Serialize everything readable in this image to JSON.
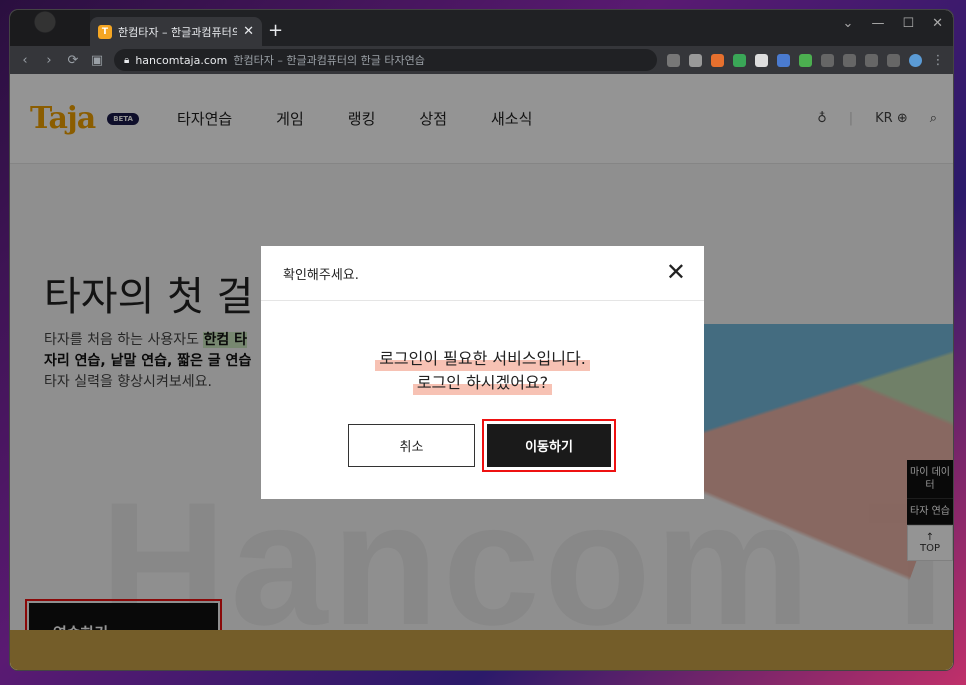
{
  "browser": {
    "tab_title": "한컴타자 – 한글과컴퓨터의",
    "tab_close": "✕",
    "new_tab": "+",
    "url": "hancomtaja.com",
    "url_title": "한컴타자 – 한글과컴퓨터의 한글 타자연습",
    "window_controls": [
      "⌄",
      "—",
      "☐",
      "✕"
    ]
  },
  "header": {
    "logo": "Taja",
    "beta": "BETA",
    "nav": [
      "타자연습",
      "게임",
      "랭킹",
      "상점",
      "새소식"
    ],
    "lang": "KR"
  },
  "hero": {
    "title": "타자의 첫 걸",
    "desc_1": "타자를 처음 하는 사용자도",
    "desc_hl": "한컴 타",
    "desc_2": "자리 연습, 낱말 연습, 짧은 글 연습",
    "desc_3": "타자 실력을 향상시켜보세요.",
    "cta": "연습하기",
    "bigword": "Hancom Ta"
  },
  "side_rail": {
    "my_data": "마이 데이터",
    "typing": "타자 연습",
    "top": "TOP"
  },
  "modal": {
    "title": "확인해주세요.",
    "close": "✕",
    "line1": "로그인이 필요한 서비스입니다.",
    "line2": "로그인 하시겠어요?",
    "cancel": "취소",
    "confirm": "이동하기"
  }
}
